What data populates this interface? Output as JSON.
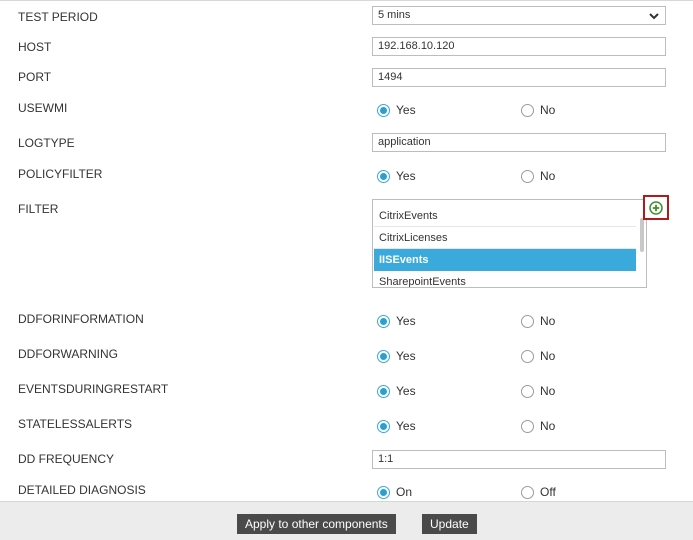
{
  "form": {
    "test_period": {
      "label": "TEST PERIOD",
      "value": "5 mins"
    },
    "host": {
      "label": "HOST",
      "value": "192.168.10.120"
    },
    "port": {
      "label": "PORT",
      "value": "1494"
    },
    "usewmi": {
      "label": "USEWMI",
      "yes": "Yes",
      "no": "No",
      "selected": "Yes"
    },
    "logtype": {
      "label": "LOGTYPE",
      "value": "application"
    },
    "policyfilter": {
      "label": "POLICYFILTER",
      "yes": "Yes",
      "no": "No",
      "selected": "Yes"
    },
    "filter": {
      "label": "FILTER",
      "items": [
        "CitrixEvents",
        "CitrixLicenses",
        "IISEvents",
        "SharepointEvents"
      ],
      "selected": "IISEvents",
      "add_icon": "plus-circle-icon"
    },
    "ddforinformation": {
      "label": "DDFORINFORMATION",
      "yes": "Yes",
      "no": "No",
      "selected": "Yes"
    },
    "ddforwarning": {
      "label": "DDFORWARNING",
      "yes": "Yes",
      "no": "No",
      "selected": "Yes"
    },
    "eventsduringrestart": {
      "label": "EVENTSDURINGRESTART",
      "yes": "Yes",
      "no": "No",
      "selected": "Yes"
    },
    "statelessalerts": {
      "label": "STATELESSALERTS",
      "yes": "Yes",
      "no": "No",
      "selected": "Yes"
    },
    "dd_frequency": {
      "label": "DD FREQUENCY",
      "value": "1:1"
    },
    "detailed_diagnosis": {
      "label": "DETAILED DIAGNOSIS",
      "on": "On",
      "off": "Off",
      "selected": "On"
    }
  },
  "footer": {
    "apply_label": "Apply to other components",
    "update_label": "Update"
  },
  "colors": {
    "accent": "#2aa0d0",
    "selected_row": "#3aa9dc",
    "button_bg": "#4a4a4a",
    "add_border": "#b01a1a",
    "add_icon": "#3f8f2c"
  }
}
